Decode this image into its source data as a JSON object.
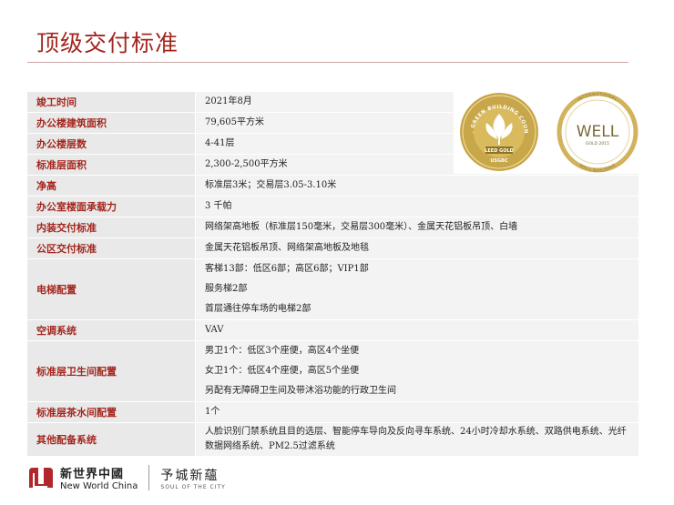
{
  "page": {
    "title": "顶级交付标准"
  },
  "spec_rows": [
    {
      "label": "竣工时间",
      "values": [
        "2021年8月"
      ]
    },
    {
      "label": "办公楼建筑面积",
      "values": [
        "79,605平方米"
      ]
    },
    {
      "label": "办公楼层数",
      "values": [
        "4-41层"
      ]
    },
    {
      "label": "标准层面积",
      "values": [
        "2,300-2,500平方米"
      ]
    },
    {
      "label": "净高",
      "values": [
        "标准层3米；交易层3.05-3.10米"
      ]
    },
    {
      "label": "办公室楼面承载力",
      "values": [
        "3 千帕"
      ]
    },
    {
      "label": "内装交付标准",
      "values": [
        "网络架高地板（标准层150毫米，交易层300毫米）、金属天花铝板吊顶、白墙"
      ]
    },
    {
      "label": "公区交付标准",
      "values": [
        "金属天花铝板吊顶、网络架高地板及地毯"
      ]
    },
    {
      "label": "电梯配置",
      "values": [
        "客梯13部：低区6部；高区6部；VIP1部",
        "服务梯2部",
        "首层通往停车场的电梯2部"
      ]
    },
    {
      "label": "空调系统",
      "values": [
        "VAV"
      ]
    },
    {
      "label": "标准层卫生间配置",
      "values": [
        "男卫1个：低区3个座便，高区4个坐便",
        "女卫1个：低区4个座便，高区5个坐便",
        "另配有无障碍卫生间及带沐浴功能的行政卫生间"
      ]
    },
    {
      "label": "标准层茶水间配置",
      "values": [
        "1个"
      ]
    },
    {
      "label": "其他配备系统",
      "values": [
        "人脸识别门禁系统且目的选层、智能停车导向及反向寻车系统、24小时冷却水系统、双路供电系统、光纤数据网络系统、PM2.5过滤系统"
      ]
    }
  ],
  "badges": {
    "leed": {
      "ring_top": "U.S. GREEN BUILDING COUNCIL",
      "ring_left": "U.S.",
      "level": "LEED GOLD",
      "bottom": "USGBC"
    },
    "well": {
      "ring_top": "INTERNATIONAL",
      "name": "WELL",
      "level": "GOLD 2015",
      "ring_bottom": "WELL BUILDING"
    }
  },
  "footer": {
    "brand_cn": "新世界中國",
    "brand_en": "New World China",
    "slogan_cn": "予城新蘊",
    "slogan_en": "SOUL OF THE CITY"
  },
  "colors": {
    "accent": "#a3271f",
    "label_bg": "#e9e9e9",
    "value_bg": "#f3f3f3",
    "gold": "#c8a64a"
  }
}
